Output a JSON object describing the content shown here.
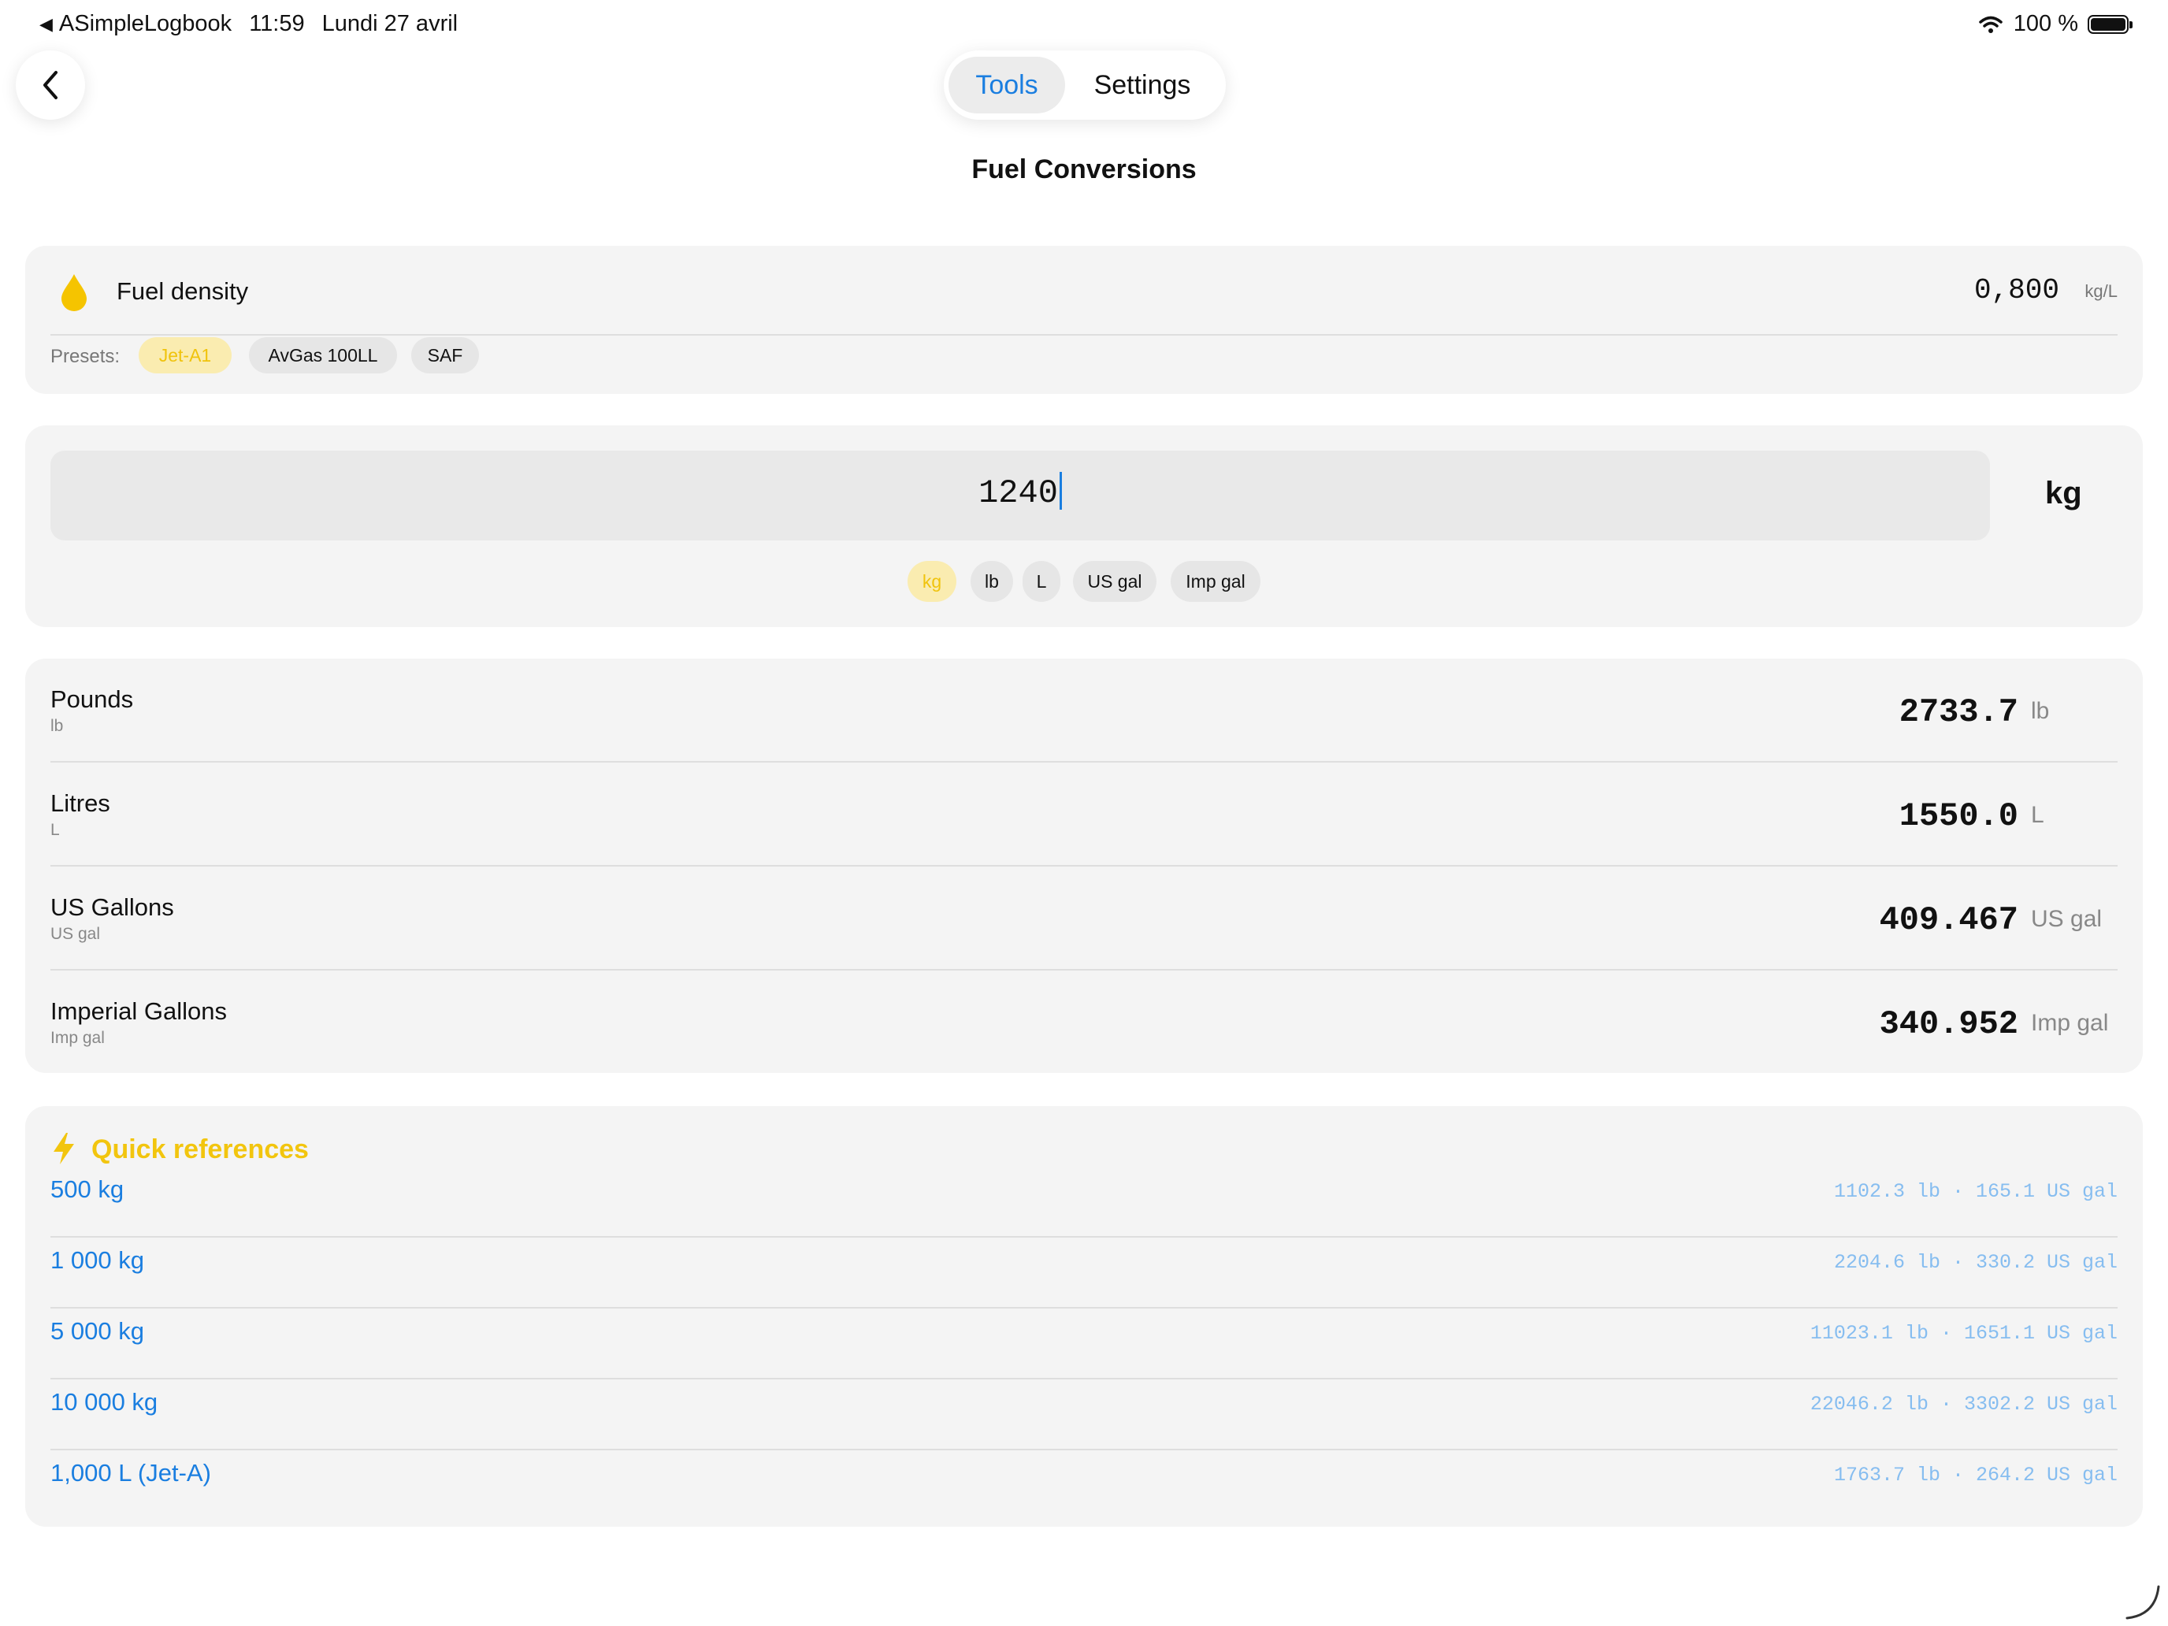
{
  "status_bar": {
    "back_app": "ASimpleLogbook",
    "time": "11:59",
    "date": "Lundi 27 avril",
    "battery": "100 %"
  },
  "nav": {
    "tabs": [
      {
        "label": "Tools",
        "active": true
      },
      {
        "label": "Settings",
        "active": false
      }
    ],
    "title": "Fuel Conversions"
  },
  "density": {
    "label": "Fuel density",
    "value": "0,800",
    "unit": "kg/L",
    "presets_label": "Presets:",
    "presets": [
      {
        "label": "Jet-A1",
        "selected": true
      },
      {
        "label": "AvGas 100LL",
        "selected": false
      },
      {
        "label": "SAF",
        "selected": false
      }
    ]
  },
  "input": {
    "value": "1240",
    "unit": "kg",
    "unit_options": [
      {
        "label": "kg",
        "selected": true
      },
      {
        "label": "lb",
        "selected": false
      },
      {
        "label": "L",
        "selected": false
      },
      {
        "label": "US gal",
        "selected": false
      },
      {
        "label": "Imp gal",
        "selected": false
      }
    ]
  },
  "results": [
    {
      "name": "Pounds",
      "sub": "lb",
      "value": "2733.7",
      "unit": "lb"
    },
    {
      "name": "Litres",
      "sub": "L",
      "value": "1550.0",
      "unit": "L"
    },
    {
      "name": "US Gallons",
      "sub": "US gal",
      "value": "409.467",
      "unit": "US gal"
    },
    {
      "name": "Imperial Gallons",
      "sub": "Imp gal",
      "value": "340.952",
      "unit": "Imp gal"
    }
  ],
  "quick_refs": {
    "title": "Quick references",
    "items": [
      {
        "label": "500 kg",
        "detail": "1102.3 lb · 165.1 US gal"
      },
      {
        "label": "1 000 kg",
        "detail": "2204.6 lb · 330.2 US gal"
      },
      {
        "label": "5 000 kg",
        "detail": "11023.1 lb · 1651.1 US gal"
      },
      {
        "label": "10 000 kg",
        "detail": "22046.2 lb · 3302.2 US gal"
      },
      {
        "label": "1,000 L (Jet-A)",
        "detail": "1763.7 lb · 264.2 US gal"
      }
    ]
  },
  "colors": {
    "accent": "#1a7ee0",
    "highlight": "#f2c50e",
    "card": "#f4f4f4"
  },
  "icons": [
    "back-chevron-icon",
    "fuel-drop-icon",
    "lightning-bolt-icon",
    "wifi-icon",
    "battery-icon"
  ]
}
